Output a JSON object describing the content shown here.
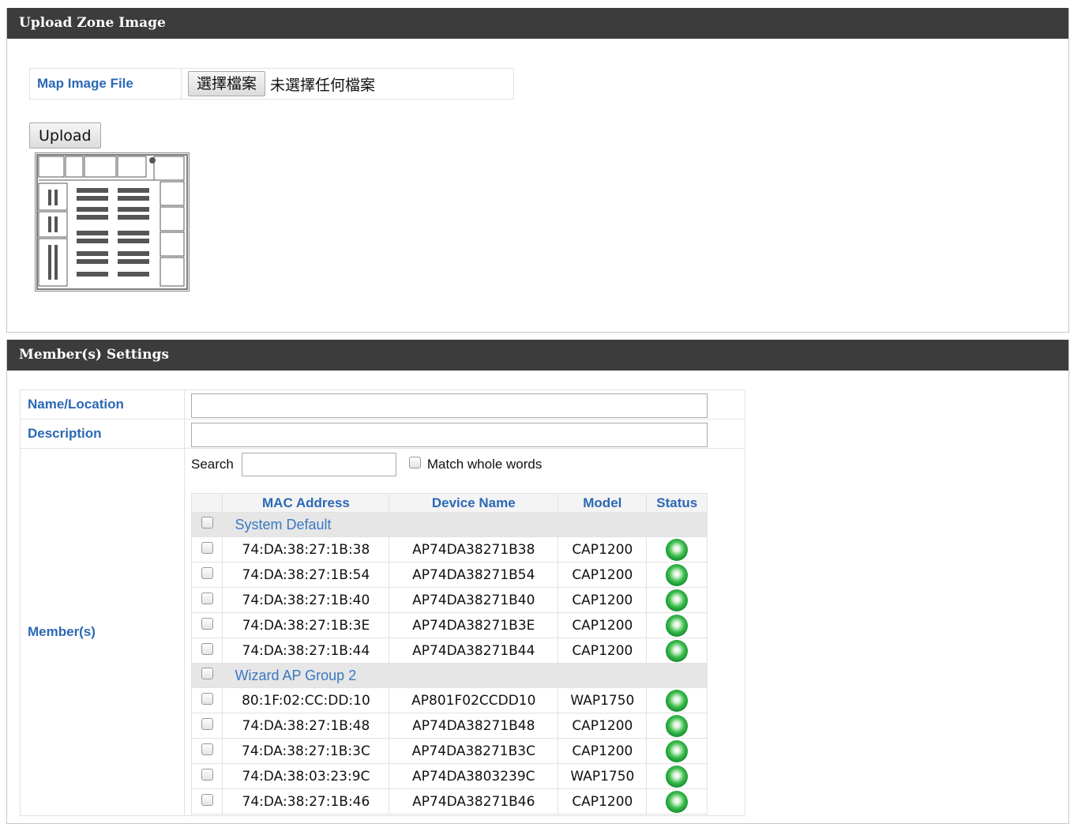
{
  "upload_panel": {
    "title": "Upload Zone Image",
    "file_label": "Map Image File",
    "choose_button": "選擇檔案",
    "file_status": "未選擇任何檔案",
    "upload_button": "Upload",
    "thumbnail": "floor-plan-thumbnail"
  },
  "members_panel": {
    "title": "Member(s) Settings",
    "name_label": "Name/Location",
    "name_value": "",
    "description_label": "Description",
    "description_value": "",
    "members_label": "Member(s)",
    "search_label": "Search",
    "search_value": "",
    "match_label": "Match whole words",
    "columns": [
      "MAC Address",
      "Device Name",
      "Model",
      "Status"
    ],
    "groups": [
      {
        "name": "System Default",
        "devices": [
          {
            "mac": "74:DA:38:27:1B:38",
            "name": "AP74DA38271B38",
            "model": "CAP1200",
            "status": "online"
          },
          {
            "mac": "74:DA:38:27:1B:54",
            "name": "AP74DA38271B54",
            "model": "CAP1200",
            "status": "online"
          },
          {
            "mac": "74:DA:38:27:1B:40",
            "name": "AP74DA38271B40",
            "model": "CAP1200",
            "status": "online"
          },
          {
            "mac": "74:DA:38:27:1B:3E",
            "name": "AP74DA38271B3E",
            "model": "CAP1200",
            "status": "online"
          },
          {
            "mac": "74:DA:38:27:1B:44",
            "name": "AP74DA38271B44",
            "model": "CAP1200",
            "status": "online"
          }
        ]
      },
      {
        "name": "Wizard AP Group 2",
        "devices": [
          {
            "mac": "80:1F:02:CC:DD:10",
            "name": "AP801F02CCDD10",
            "model": "WAP1750",
            "status": "online"
          },
          {
            "mac": "74:DA:38:27:1B:48",
            "name": "AP74DA38271B48",
            "model": "CAP1200",
            "status": "online"
          },
          {
            "mac": "74:DA:38:27:1B:3C",
            "name": "AP74DA38271B3C",
            "model": "CAP1200",
            "status": "online"
          },
          {
            "mac": "74:DA:38:03:23:9C",
            "name": "AP74DA3803239C",
            "model": "WAP1750",
            "status": "online"
          },
          {
            "mac": "74:DA:38:27:1B:46",
            "name": "AP74DA38271B46",
            "model": "CAP1200",
            "status": "online"
          }
        ]
      }
    ]
  },
  "colors": {
    "header_bg": "#3c3c3c",
    "label_blue": "#2b68b5",
    "group_bg": "#e6e6e6",
    "status_online": "#1a9a35"
  }
}
